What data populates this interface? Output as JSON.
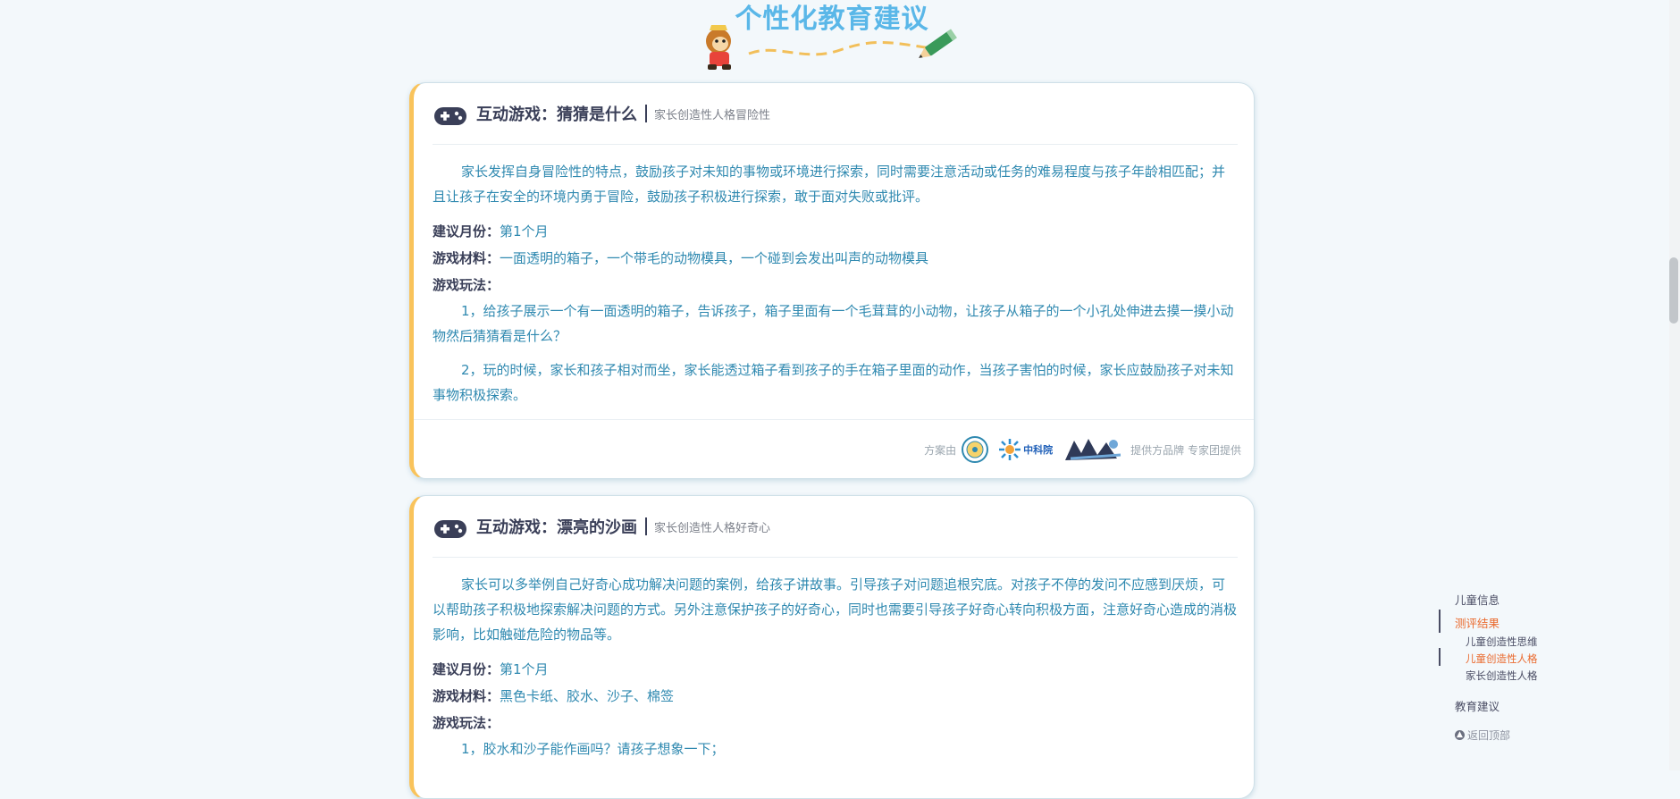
{
  "page": {
    "title": "个性化教育建议"
  },
  "labels": {
    "month": "建议月份：",
    "materials": "游戏材料：",
    "method": "游戏玩法："
  },
  "cards": [
    {
      "title": "互动游戏：猜猜是什么",
      "subtitle": "家长创造性人格冒险性",
      "description": "家长发挥自身冒险性的特点，鼓励孩子对未知的事物或环境进行探索，同时需要注意活动或任务的难易程度与孩子年龄相匹配；并且让孩子在安全的环境内勇于冒险，鼓励孩子积极进行探索，敢于面对失败或批评。",
      "month": "第1个月",
      "materials": "一面透明的箱子，一个带毛的动物模具，一个碰到会发出叫声的动物模具",
      "steps": [
        "1，给孩子展示一个有一面透明的箱子，告诉孩子，箱子里面有一个毛茸茸的小动物，让孩子从箱子的一个小孔处伸进去摸一摸小动物然后猜猜看是什么？",
        "2，玩的时候，家长和孩子相对而坐，家长能透过箱子看到孩子的手在箱子里面的动作，当孩子害怕的时候，家长应鼓励孩子对未知事物积极探索。"
      ],
      "footer": {
        "prefix": "方案由",
        "logo_text": "中科院",
        "suffix": "提供方品牌 专家团提供"
      }
    },
    {
      "title": "互动游戏：漂亮的沙画",
      "subtitle": "家长创造性人格好奇心",
      "description": "家长可以多举例自己好奇心成功解决问题的案例，给孩子讲故事。引导孩子对问题追根究底。对孩子不停的发问不应感到厌烦，可以帮助孩子积极地探索解决问题的方式。另外注意保护孩子的好奇心，同时也需要引导孩子好奇心转向积极方面，注意好奇心造成的消极影响，比如触碰危险的物品等。",
      "month": "第1个月",
      "materials": "黑色卡纸、胶水、沙子、棉签",
      "steps": [
        "1，胶水和沙子能作画吗？请孩子想象一下；"
      ]
    }
  ],
  "side_nav": {
    "items": [
      "儿童信息",
      "测评结果",
      "教育建议"
    ],
    "sub_items": [
      "儿童创造性思维",
      "儿童创造性人格",
      "家长创造性人格"
    ],
    "back_to_top": "返回顶部",
    "active_color": "#ea6a2e"
  },
  "colors": {
    "title": "#5ab7e8",
    "accent_border": "#f9c35b",
    "body_text": "#2f89b0"
  }
}
